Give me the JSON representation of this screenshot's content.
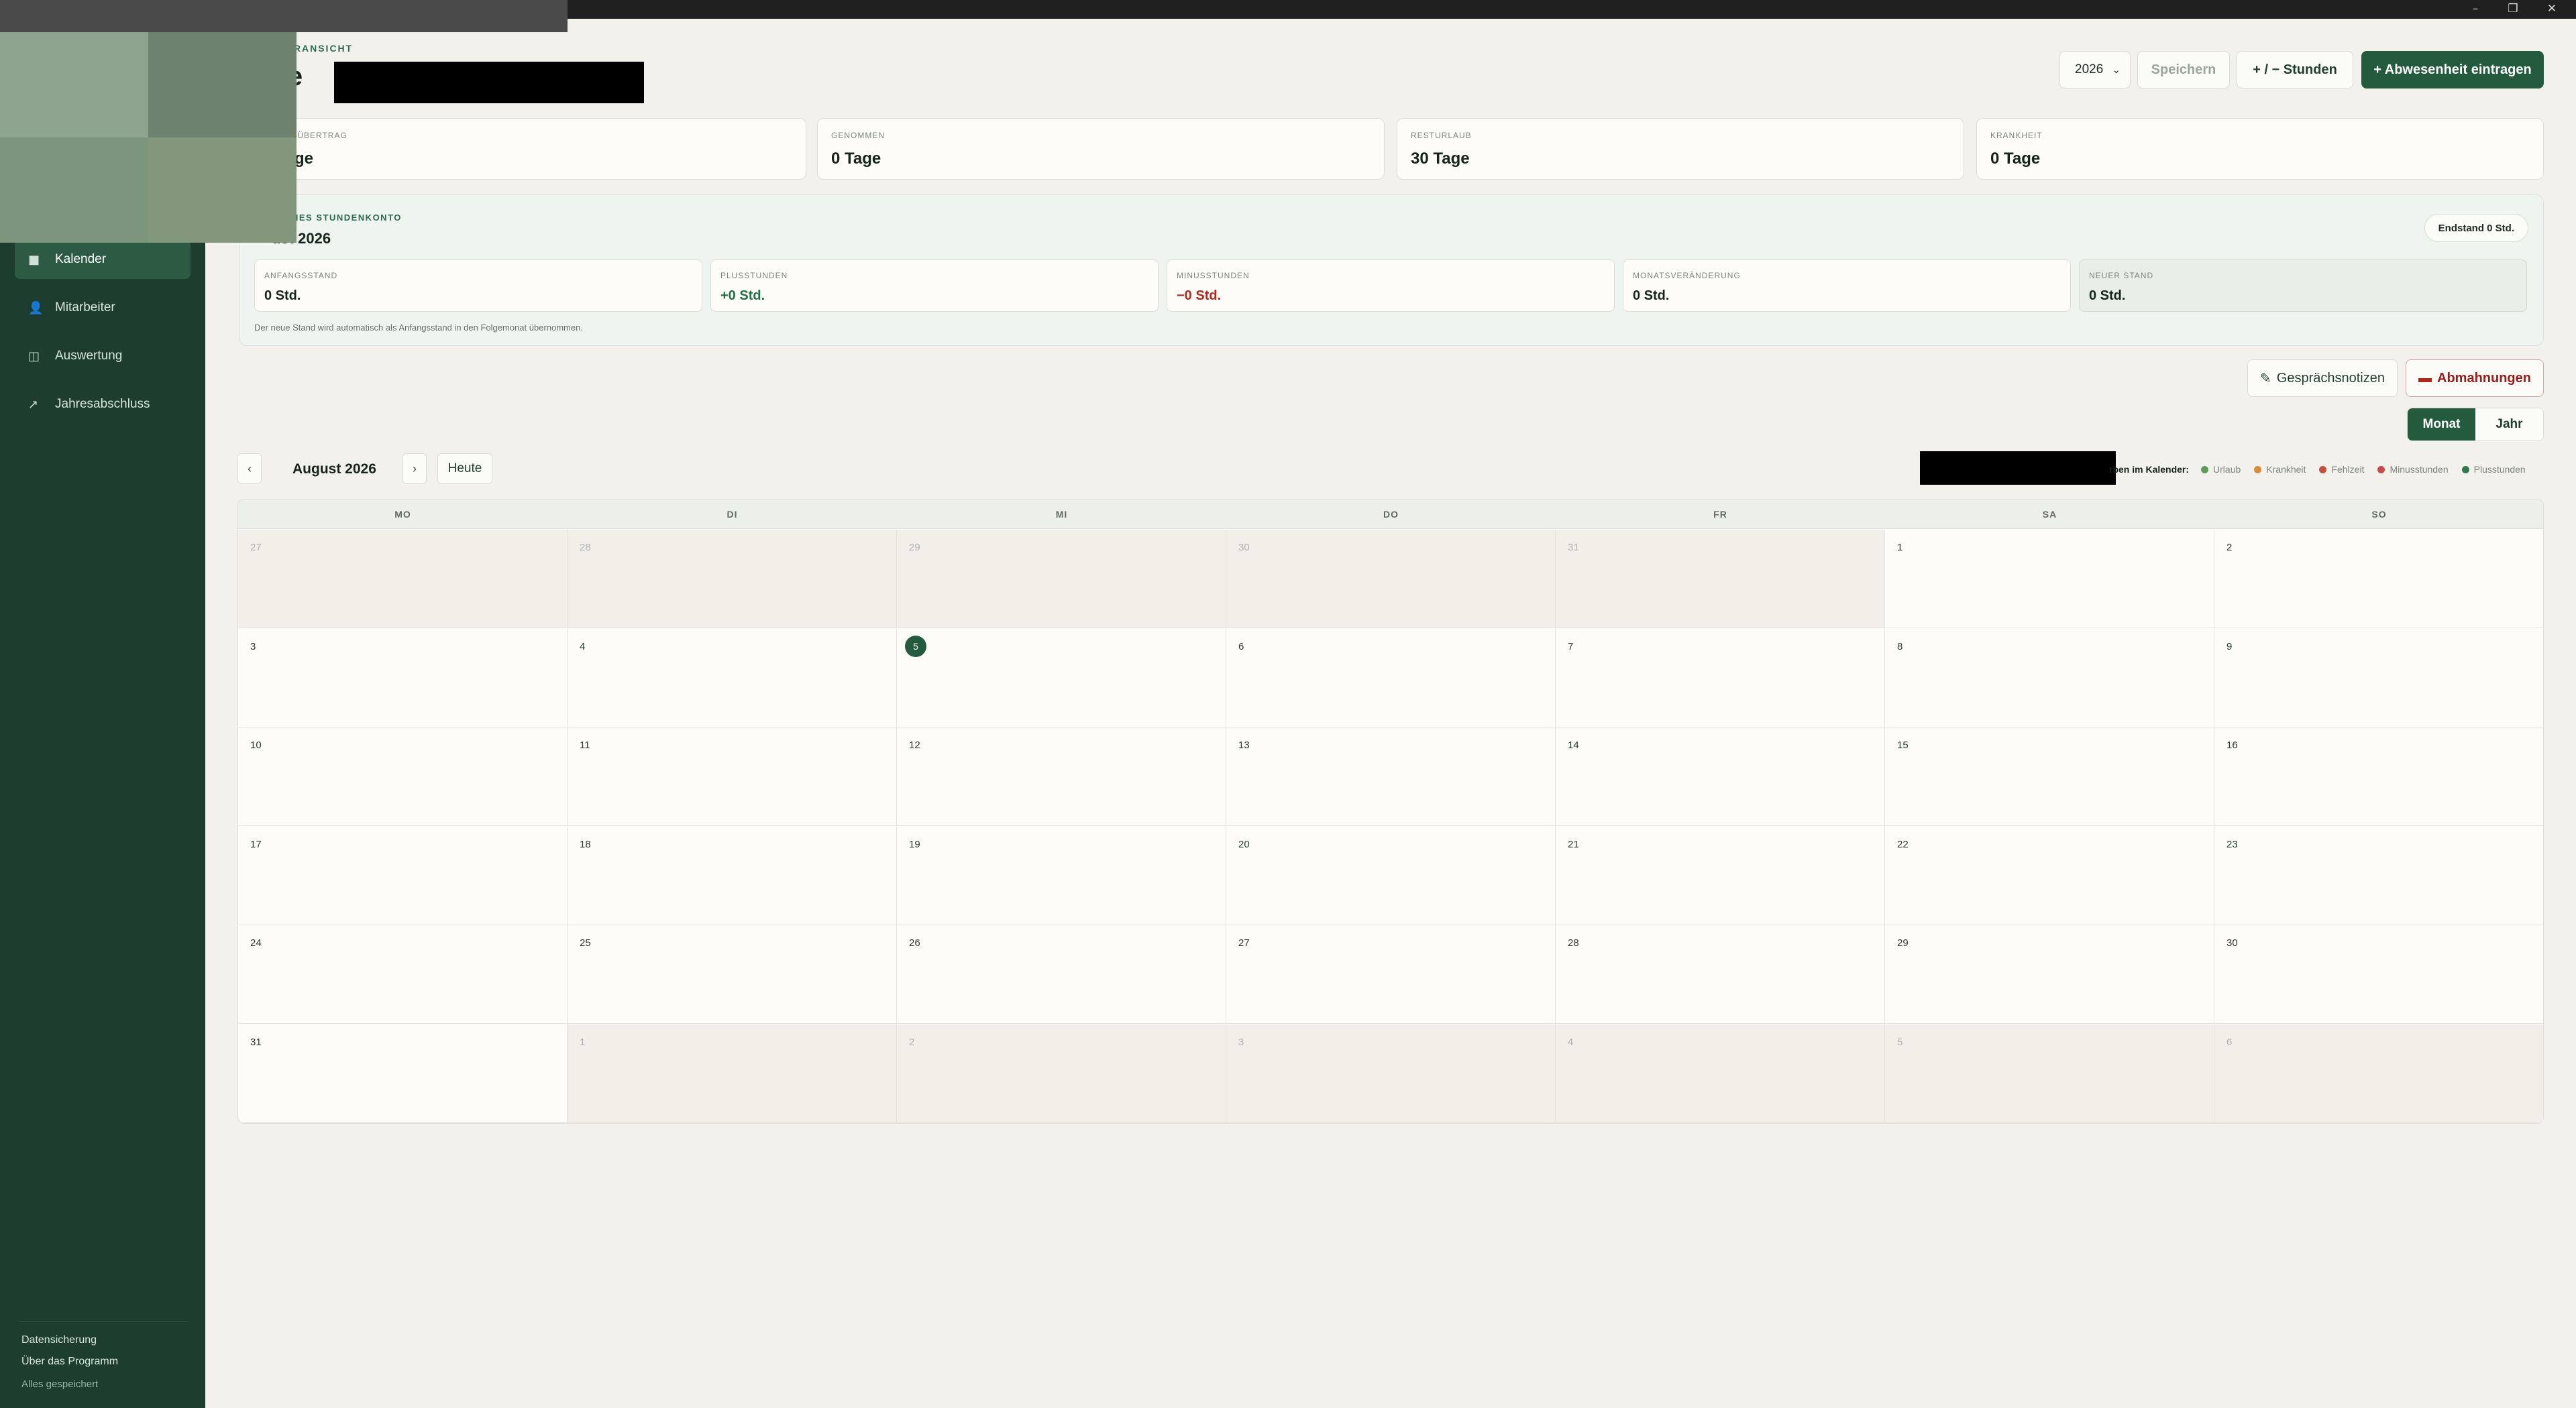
{
  "window": {
    "minimize": "–",
    "maximize": "❐",
    "close": "✕"
  },
  "sidebar": {
    "items": [
      {
        "label": "Kalender",
        "icon": "calendar-icon",
        "glyph": "■",
        "active": true
      },
      {
        "label": "Mitarbeiter",
        "icon": "person-icon",
        "glyph": "👤",
        "active": false
      },
      {
        "label": "Auswertung",
        "icon": "columns-icon",
        "glyph": "◫",
        "active": false
      },
      {
        "label": "Jahresabschluss",
        "icon": "arrow-up-right-icon",
        "glyph": "↗",
        "active": false
      }
    ],
    "footer_links": [
      "Datensicherung",
      "Über das Programm"
    ],
    "status": "Alles gespeichert"
  },
  "header": {
    "eyebrow": "TERANSICHT",
    "title": "nde",
    "year": "2026",
    "save": "Speichern",
    "hours": "+ / − Stunden",
    "absence": "+ Abwesenheit eintragen"
  },
  "stats": [
    {
      "label": "H + ÜBERTRAG",
      "value": "ge"
    },
    {
      "label": "GENOMMEN",
      "value": "0 Tage"
    },
    {
      "label": "RESTURLAUB",
      "value": "30 Tage"
    },
    {
      "label": "KRANKHEIT",
      "value": "0 Tage"
    }
  ],
  "hours_account": {
    "eyebrow": "ICHES STUNDENKONTO",
    "month": "ust 2026",
    "end_badge": "Endstand 0 Std.",
    "tiles": [
      {
        "label": "ANFANGSSTAND",
        "value": "0 Std."
      },
      {
        "label": "PLUSSTUNDEN",
        "value": "+0 Std."
      },
      {
        "label": "MINUSSTUNDEN",
        "value": "−0 Std."
      },
      {
        "label": "MONATSVERÄNDERUNG",
        "value": "0 Std."
      },
      {
        "label": "NEUER STAND",
        "value": "0 Std."
      }
    ],
    "note": "Der neue Stand wird automatisch als Anfangsstand in den Folgemonat übernommen."
  },
  "actions": {
    "notes": "Gesprächsnotizen",
    "notes_icon": "✎",
    "warnings": "Abmahnungen",
    "warnings_icon": "▬"
  },
  "view_toggle": {
    "month": "Monat",
    "year": "Jahr"
  },
  "calendar": {
    "prev": "‹",
    "next": "›",
    "month": "August 2026",
    "today": "Heute",
    "legend_title": "rben im Kalender:",
    "legend": [
      {
        "label": "Urlaub",
        "color": "#5e9a5e"
      },
      {
        "label": "Krankheit",
        "color": "#d98b3a"
      },
      {
        "label": "Fehlzeit",
        "color": "#c2503a"
      },
      {
        "label": "Minusstunden",
        "color": "#c94b4b"
      },
      {
        "label": "Plusstunden",
        "color": "#2e7a4d"
      }
    ],
    "weekdays": [
      "MO",
      "DI",
      "MI",
      "DO",
      "FR",
      "SA",
      "SO"
    ],
    "weeks": [
      [
        [
          "27",
          0
        ],
        [
          "28",
          0
        ],
        [
          "29",
          0
        ],
        [
          "30",
          0
        ],
        [
          "31",
          0
        ],
        [
          "1",
          1
        ],
        [
          "2",
          1
        ]
      ],
      [
        [
          "3",
          1
        ],
        [
          "4",
          1
        ],
        [
          "5",
          2
        ],
        [
          "6",
          1
        ],
        [
          "7",
          1
        ],
        [
          "8",
          1
        ],
        [
          "9",
          1
        ]
      ],
      [
        [
          "10",
          1
        ],
        [
          "11",
          1
        ],
        [
          "12",
          1
        ],
        [
          "13",
          1
        ],
        [
          "14",
          1
        ],
        [
          "15",
          1
        ],
        [
          "16",
          1
        ]
      ],
      [
        [
          "17",
          1
        ],
        [
          "18",
          1
        ],
        [
          "19",
          1
        ],
        [
          "20",
          1
        ],
        [
          "21",
          1
        ],
        [
          "22",
          1
        ],
        [
          "23",
          1
        ]
      ],
      [
        [
          "24",
          1
        ],
        [
          "25",
          1
        ],
        [
          "26",
          1
        ],
        [
          "27",
          1
        ],
        [
          "28",
          1
        ],
        [
          "29",
          1
        ],
        [
          "30",
          1
        ]
      ],
      [
        [
          "31",
          1
        ],
        [
          "1",
          0
        ],
        [
          "2",
          0
        ],
        [
          "3",
          0
        ],
        [
          "4",
          0
        ],
        [
          "5",
          0
        ],
        [
          "6",
          0
        ]
      ]
    ]
  }
}
